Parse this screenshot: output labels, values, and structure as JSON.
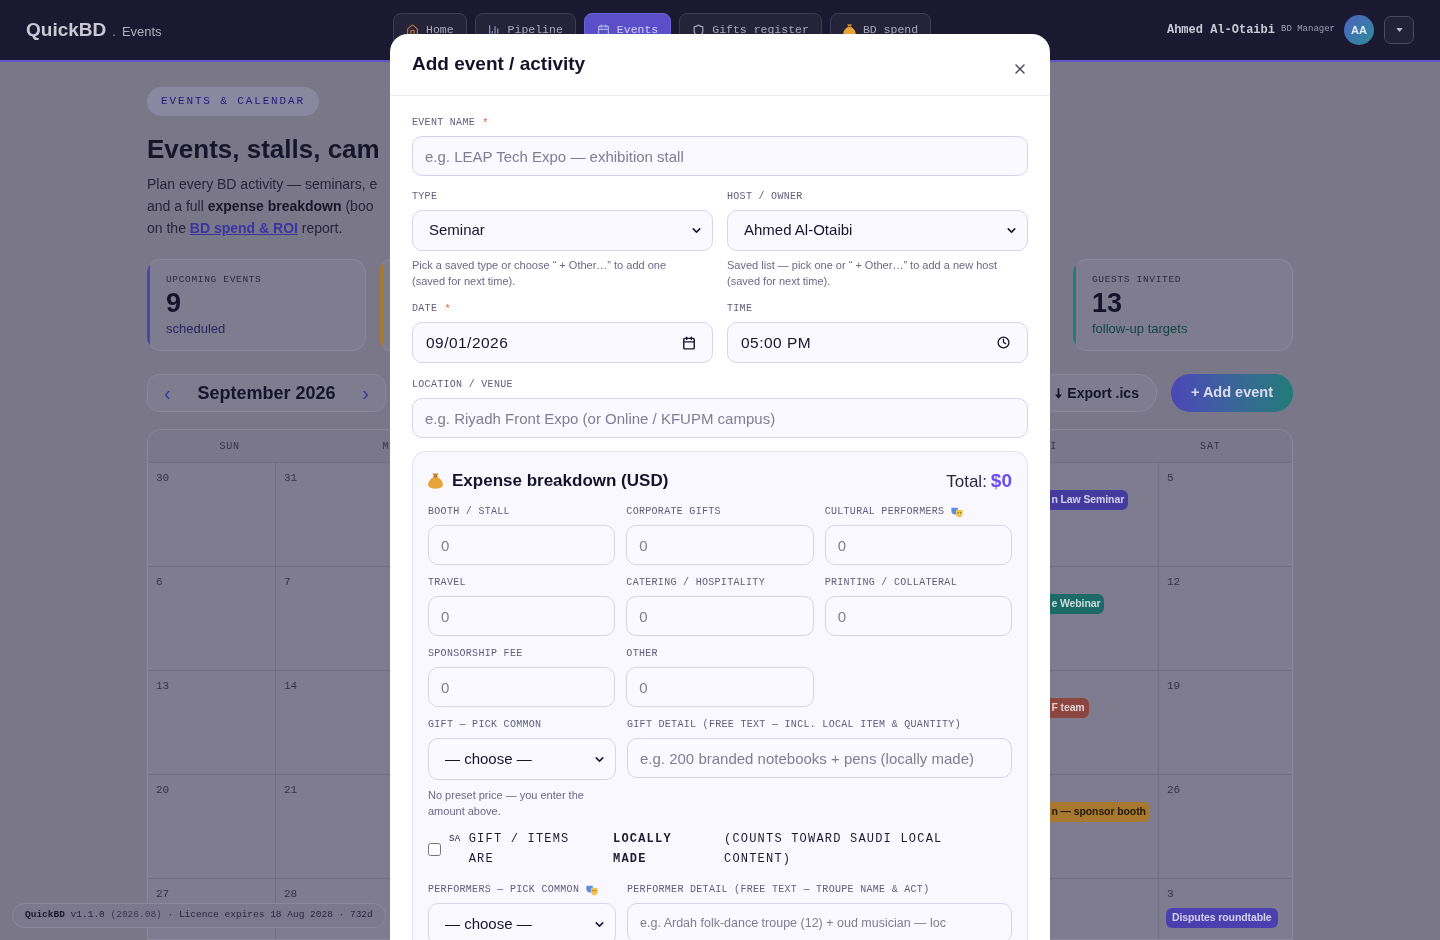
{
  "header": {
    "logo": "QuickBD",
    "separator": ".",
    "section": "Events",
    "tabs": [
      {
        "label": "Home",
        "selected": false
      },
      {
        "label": "Pipeline",
        "selected": false
      },
      {
        "label": "Events",
        "selected": true
      },
      {
        "label": "Gifts register",
        "selected": false
      },
      {
        "label": "BD spend",
        "selected": false
      }
    ],
    "user": {
      "name": "Ahmed Al-Otaibi",
      "role": "BD Manager",
      "initials": "AA"
    }
  },
  "page": {
    "eyebrow": "EVENTS & CALENDAR",
    "title": "Events, stalls, cam",
    "intro": {
      "lines": [
        "Plan every BD activity — seminars, e",
        "and a full **expense breakdown** (boo"
      ],
      "before_link": "on the ",
      "link": "BD spend & ROI",
      "after_link": " report."
    },
    "stats": [
      {
        "label": "UPCOMING EVENTS",
        "value": "9",
        "note": "scheduled",
        "color": "#4a43b0"
      },
      {
        "color": "#a87a30"
      },
      {
        "label": "GUESTS INVITED",
        "value": "13",
        "note": "follow-up targets",
        "color": "#1f8078"
      }
    ],
    "calendar": {
      "prev": "‹",
      "month": "September 2026",
      "next": "›",
      "export": "Export .ics",
      "add": "+ Add event",
      "weekdays": [
        "SUN",
        "M",
        "I",
        "SAT"
      ],
      "weeks": [
        {
          "cells": [
            {
              "day": "30"
            },
            {
              "day": "31"
            },
            {
              "event": {
                "title": "n Law Seminar",
                "color": "#453b9e"
              }
            },
            {
              "day": "5"
            }
          ]
        },
        {
          "cells": [
            {
              "day": "6"
            },
            {
              "day": "7"
            },
            {
              "event": {
                "title": "e Webinar",
                "color": "#1b6a67"
              }
            },
            {
              "day": "12"
            }
          ]
        },
        {
          "cells": [
            {
              "day": "13"
            },
            {
              "day": "14"
            },
            {
              "event": {
                "title": "F team",
                "color": "#8c4640"
              }
            },
            {
              "day": "19"
            }
          ]
        },
        {
          "cells": [
            {
              "day": "20"
            },
            {
              "day": "21"
            },
            {
              "event": {
                "title": "n — sponsor booth",
                "color": "#a8782f"
              }
            },
            {
              "day": "26"
            }
          ]
        },
        {
          "cells": [
            {
              "day": "27"
            },
            {
              "day": "28"
            },
            {
              "day": "3",
              "event": {
                "title": "Disputes roundtable",
                "color": "#4a3fae"
              }
            }
          ]
        }
      ]
    }
  },
  "footer": {
    "app": "QuickBD",
    "version": "v1.1.0",
    "build": "(2026.08)",
    "licence": "· Licence expires 18 Aug 2028 · 732d"
  },
  "modal": {
    "title": "Add event / activity",
    "event_name": {
      "label": "EVENT NAME",
      "required_mark": "*",
      "placeholder": "e.g. LEAP Tech Expo — exhibition stall"
    },
    "type": {
      "label": "TYPE",
      "value": "Seminar",
      "hint": "Pick a saved type or choose “ + Other…” to add one (saved for next time)."
    },
    "host": {
      "label": "HOST / OWNER",
      "value": "Ahmed Al-Otaibi",
      "hint": "Saved list — pick one or “ + Other…” to add a new host (saved for next time)."
    },
    "date": {
      "label": "DATE",
      "required_mark": "*",
      "value": "09/01/2026"
    },
    "time": {
      "label": "TIME",
      "value": "05:00 PM"
    },
    "location": {
      "label": "LOCATION / VENUE",
      "placeholder": "e.g. Riyadh Front Expo (or Online / KFUPM campus)"
    },
    "expenses": {
      "title": "Expense breakdown (USD)",
      "total_label": "Total:",
      "total": "$0",
      "items": [
        {
          "label": "BOOTH / STALL",
          "placeholder": "0"
        },
        {
          "label": "CORPORATE GIFTS",
          "placeholder": "0"
        },
        {
          "label": "CULTURAL PERFORMERS",
          "placeholder": "0"
        },
        {
          "label": "TRAVEL",
          "placeholder": "0"
        },
        {
          "label": "CATERING / HOSPITALITY",
          "placeholder": "0"
        },
        {
          "label": "PRINTING / COLLATERAL",
          "placeholder": "0"
        },
        {
          "label": "SPONSORSHIP FEE",
          "placeholder": "0"
        },
        {
          "label": "OTHER",
          "placeholder": "0"
        }
      ]
    },
    "gift": {
      "label": "GIFT — PICK COMMON",
      "value": "— choose —",
      "hint": "No preset price — you enter the amount above.",
      "detail_label": "GIFT DETAIL (FREE TEXT — INCL. LOCAL ITEM & QUANTITY)",
      "detail_placeholder": "e.g. 200 branded notebooks + pens (locally made)"
    },
    "local_made": {
      "checked": false,
      "flag": "SA",
      "parts": [
        "GIFT / ITEMS ARE",
        "LOCALLY MADE",
        "(COUNTS TOWARD SAUDI LOCAL CONTENT)"
      ]
    },
    "performers": {
      "label": "PERFORMERS — PICK COMMON",
      "value": "— choose —",
      "detail_label": "PERFORMER DETAIL (FREE TEXT — TROUPE NAME & ACT)",
      "detail_placeholder": "e.g. Ardah folk-dance troupe (12) + oud musician — loc"
    }
  }
}
